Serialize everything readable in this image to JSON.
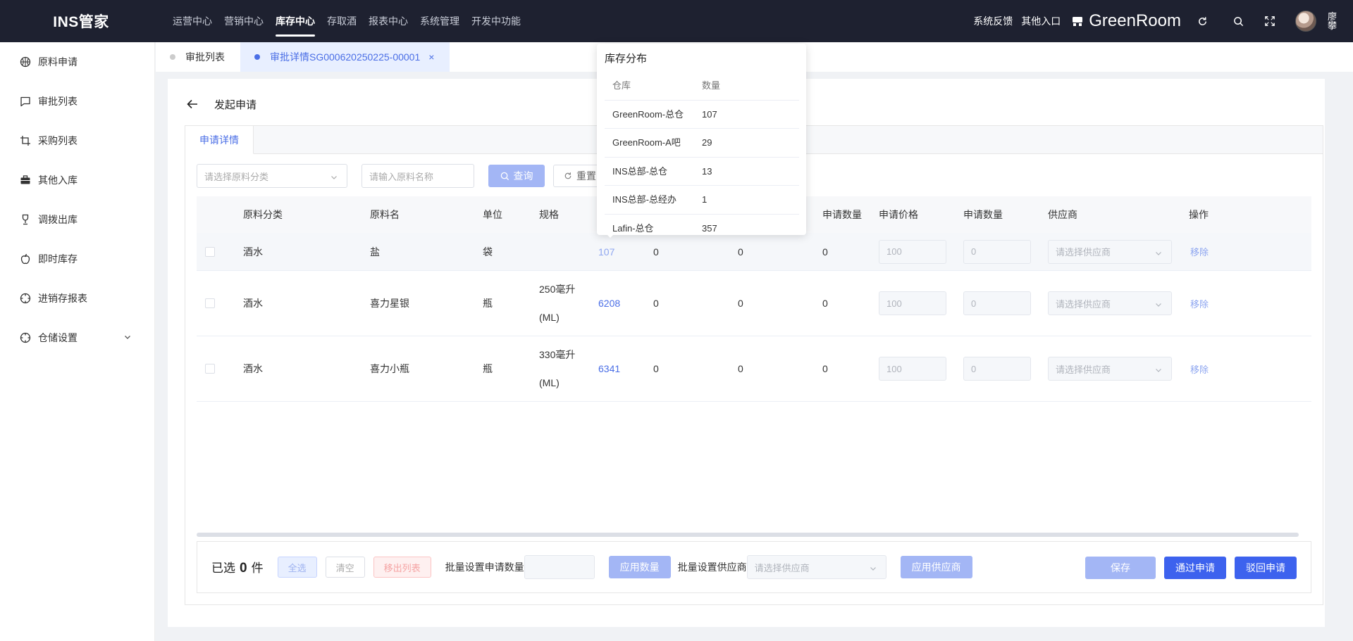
{
  "app": {
    "title": "INS管家"
  },
  "topnav": [
    {
      "label": "运营中心",
      "active": false
    },
    {
      "label": "营销中心",
      "active": false
    },
    {
      "label": "库存中心",
      "active": true
    },
    {
      "label": "存取酒",
      "active": false
    },
    {
      "label": "报表中心",
      "active": false
    },
    {
      "label": "系统管理",
      "active": false
    },
    {
      "label": "开发中功能",
      "active": false
    }
  ],
  "topright": {
    "feedback": "系统反馈",
    "other_entry": "其他入口",
    "store_name": "GreenRoom",
    "username": "廖攀"
  },
  "sidebar": {
    "items": [
      {
        "label": "原料申请",
        "icon": "basketball-icon"
      },
      {
        "label": "审批列表",
        "icon": "comment-icon"
      },
      {
        "label": "采购列表",
        "icon": "crop-icon"
      },
      {
        "label": "其他入库",
        "icon": "briefcase-icon"
      },
      {
        "label": "调拨出库",
        "icon": "trophy-icon"
      },
      {
        "label": "即时库存",
        "icon": "apple-icon"
      },
      {
        "label": "进销存报表",
        "icon": "compass-icon"
      },
      {
        "label": "仓储设置",
        "icon": "compass-icon"
      }
    ]
  },
  "tabs": [
    {
      "label": "审批列表",
      "active": false
    },
    {
      "label": "审批详情SG000620250225-00001",
      "active": true,
      "close": "×"
    }
  ],
  "page": {
    "title": "发起申请",
    "panel_tab": "申请详情"
  },
  "filters": {
    "category_placeholder": "请选择原料分类",
    "name_placeholder": "请输入原料名称",
    "query": "查询",
    "reset": "重置"
  },
  "table": {
    "headers": {
      "category": "原料分类",
      "name": "原料名",
      "unit": "单位",
      "spec": "规格",
      "apply_qty_a": "申请数量",
      "price": "申请价格",
      "apply_qty_b": "申请数量",
      "supplier": "供应商",
      "action": "操作"
    },
    "rows": [
      {
        "category": "酒水",
        "name": "盐",
        "unit": "袋",
        "spec_line1": "",
        "spec_line2": "",
        "stock": "107",
        "c1": "0",
        "c2": "0",
        "c3": "0",
        "price": "100",
        "qty": "0",
        "supplier_placeholder": "请选择供应商",
        "action": "移除"
      },
      {
        "category": "酒水",
        "name": "喜力星银",
        "unit": "瓶",
        "spec_line1": "250毫升",
        "spec_line2": "(ML)",
        "stock": "6208",
        "c1": "0",
        "c2": "0",
        "c3": "0",
        "price": "100",
        "qty": "0",
        "supplier_placeholder": "请选择供应商",
        "action": "移除"
      },
      {
        "category": "酒水",
        "name": "喜力小瓶",
        "unit": "瓶",
        "spec_line1": "330毫升",
        "spec_line2": "(ML)",
        "stock": "6341",
        "c1": "0",
        "c2": "0",
        "c3": "0",
        "price": "100",
        "qty": "0",
        "supplier_placeholder": "请选择供应商",
        "action": "移除"
      }
    ]
  },
  "footer": {
    "selected_prefix": "已选",
    "selected_count": "0",
    "selected_suffix": "件",
    "select_all": "全选",
    "clear": "清空",
    "remove_list": "移出列表",
    "batch_qty_label": "批量设置申请数量",
    "apply_qty": "应用数量",
    "batch_supplier_label": "批量设置供应商",
    "supplier_placeholder": "请选择供应商",
    "apply_supplier": "应用供应商",
    "save": "保存",
    "approve": "通过申请",
    "reject": "驳回申请"
  },
  "popover": {
    "title": "库存分布",
    "headers": {
      "warehouse": "仓库",
      "qty": "数量"
    },
    "rows": [
      {
        "warehouse": "GreenRoom-总仓",
        "qty": "107"
      },
      {
        "warehouse": "GreenRoom-A吧",
        "qty": "29"
      },
      {
        "warehouse": "INS总部-总仓",
        "qty": "13"
      },
      {
        "warehouse": "INS总部-总经办",
        "qty": "1"
      },
      {
        "warehouse": "Lafin-总仓",
        "qty": "357"
      }
    ]
  },
  "colors": {
    "topbar": "#1e2130",
    "primary": "#3d62ee",
    "primary_light": "#a3b6f5",
    "link": "#4a6ee6"
  }
}
